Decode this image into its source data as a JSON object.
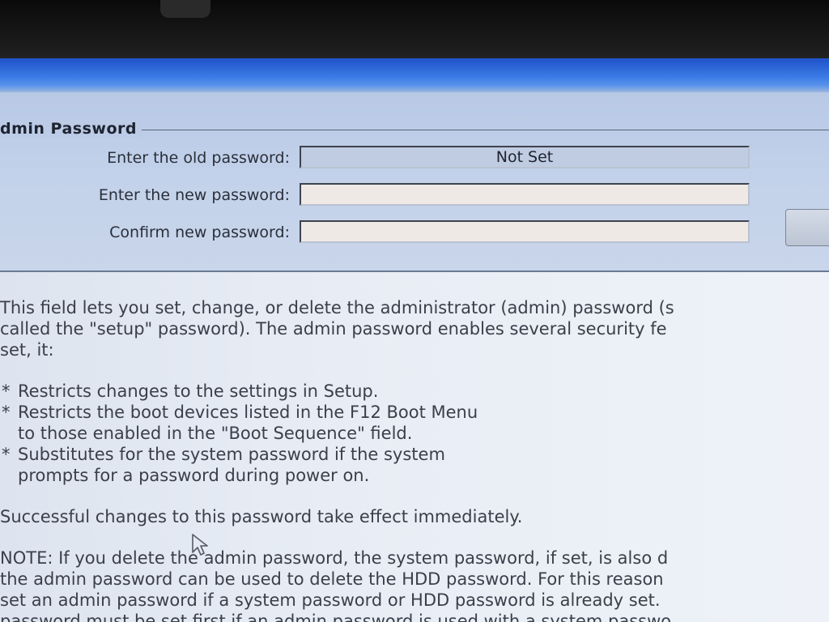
{
  "group": {
    "title": "dmin Password"
  },
  "fields": {
    "old_label": "Enter the old password:",
    "old_value": "Not Set",
    "new_label": "Enter the new password:",
    "new_value": "",
    "confirm_label": "Confirm new password:",
    "confirm_value": ""
  },
  "help": {
    "intro": [
      "This field lets you set, change, or delete the administrator (admin) password (s",
      "called the \"setup\" password).  The admin password enables several security fe",
      "set, it:"
    ],
    "bullets": [
      {
        "marker": "*",
        "lines": [
          "Restricts changes to the settings in Setup."
        ]
      },
      {
        "marker": "*",
        "lines": [
          "Restricts the boot devices listed in the F12 Boot Menu",
          "to those enabled in the \"Boot Sequence\" field."
        ]
      },
      {
        "marker": "*",
        "lines": [
          "Substitutes for the system password if the system",
          "prompts for a password during power on."
        ]
      }
    ],
    "effect": "Successful changes to this password take effect immediately.",
    "note": [
      "NOTE: If you delete the admin password, the system password, if set, is also d",
      "the admin password can be used to delete the HDD password.  For this reason",
      "set an admin password if a system password or HDD password is already set.",
      "password must be set first if an admin password is used with a system passwo"
    ]
  },
  "icons": {
    "cursor": "mouse-pointer-icon"
  },
  "colors": {
    "title_bar": "#3b7be6",
    "panel": "#c3d2ea",
    "help_background": "#e8edf5",
    "text": "#3a3f4a"
  }
}
